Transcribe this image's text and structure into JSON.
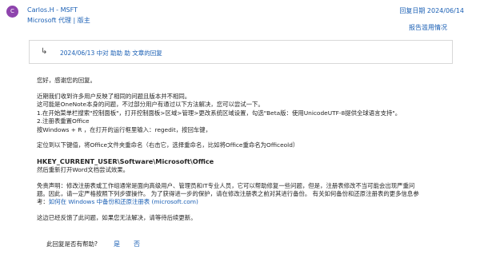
{
  "post": {
    "avatar_letter": "C",
    "author": "Carlos.H - MSFT",
    "role": "Microsoft 代理 | 版主",
    "reply_date": "回复日期 2024/06/14",
    "report_link": "报告滥用情况",
    "quote": "2024/06/13 中对 助助 助 文章的回复"
  },
  "body": {
    "greeting": "您好，感谢您的回复。",
    "p1": "近期我们收到许多用户反映了相同的问题且版本并不相同。",
    "p2": "这可能是OneNote本身的问题，不过部分用户有通过以下方法解决，您可以尝试一下。",
    "p3": "1.在开始菜单栏搜索\"控制面板\"，打开控制面板>区域>管理>更改系统区域设置，勾选\"Beta版：使用UnicodeUTF-8提供全球语言支持\"。",
    "p4": "2.注册表重置Office",
    "p5": "按Windows + R ，在打开的运行框里输入：regedit，按回车键，",
    "p6": "定位到以下键值，将Office文件夹重命名（右击它，选择重命名，比如将Office重命名为Officeold）",
    "registry_key": "HKEY_CURRENT_USER\\Software\\Microsoft\\Office",
    "p7": "然后重新打开Word文档尝试效果。",
    "disclaimer_1": "免责声明：修改注册表或工作组通常是面向高级用户、管理员和IT专业人员，它可以帮助修复一些问题，但是，注册表修改不当可能会出现严重问",
    "disclaimer_2": "题。因此，请一定严格按照下列步骤操作。 为了获得进一步的保护，请在修改注册表之前对其进行备份。 有关如何备份和还原注册表的更多信息参",
    "disclaimer_3_prefix": "考：",
    "disclaimer_link": "如何在 Windows 中备份和还原注册表 (microsoft.com)",
    "closing": "这边已经反馈了此问题，如果您无法解决，请等待后续更新。"
  },
  "footer": {
    "helpful_question": "此回复是否有帮助?",
    "yes_label": "是",
    "no_label": "否"
  }
}
